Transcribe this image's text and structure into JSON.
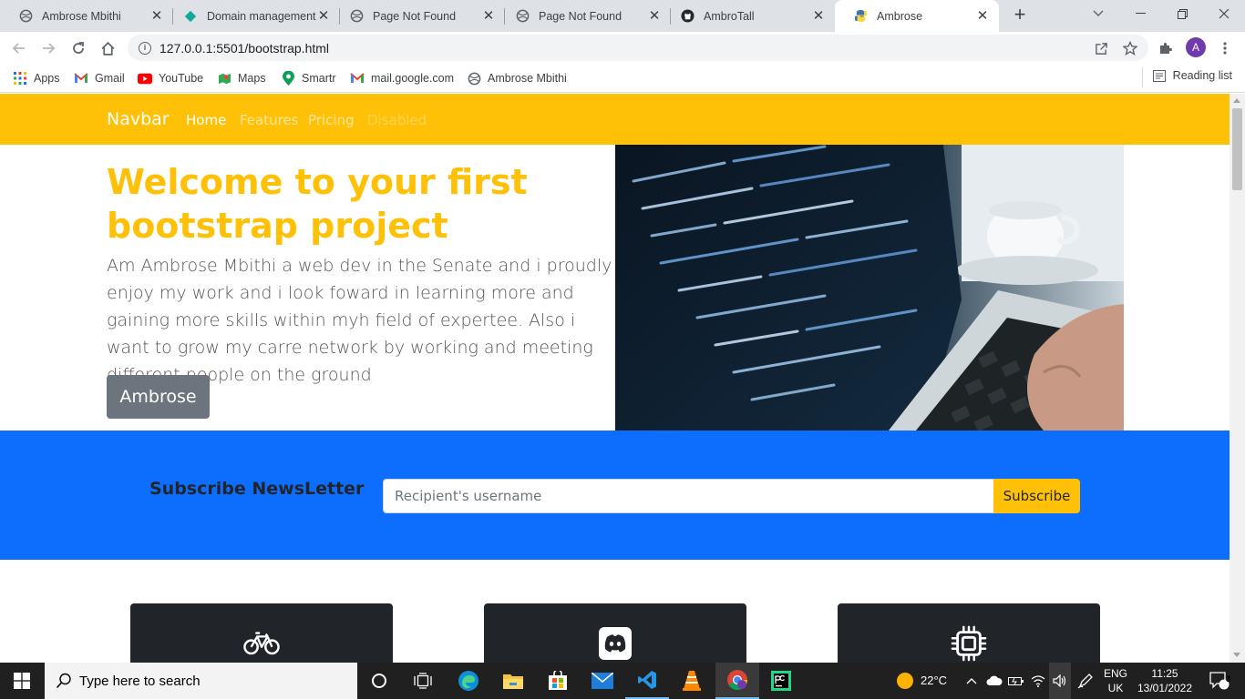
{
  "browser": {
    "tabs": [
      {
        "title": "Ambrose Mbithi",
        "icon": "globe-icon"
      },
      {
        "title": "Domain management",
        "icon": "diamond-icon"
      },
      {
        "title": "Page Not Found",
        "icon": "globe-icon"
      },
      {
        "title": "Page Not Found",
        "icon": "globe-icon"
      },
      {
        "title": "AmbroTall",
        "icon": "github-icon"
      },
      {
        "title": "Ambrose",
        "icon": "python-icon",
        "active": true
      }
    ],
    "url": "127.0.0.1:5501/bootstrap.html",
    "profile_initial": "A",
    "bookmarks": [
      "Apps",
      "Gmail",
      "YouTube",
      "Maps",
      "Smartr",
      "mail.google.com",
      "Ambrose Mbithi"
    ],
    "reading_list": "Reading list"
  },
  "page": {
    "navbar": {
      "brand": "Navbar",
      "links": [
        {
          "label": "Home",
          "state": "active"
        },
        {
          "label": "Features",
          "state": "normal"
        },
        {
          "label": "Pricing",
          "state": "normal"
        },
        {
          "label": "Disabled",
          "state": "disabled"
        }
      ]
    },
    "hero": {
      "title": "Welcome to your first bootstrap project",
      "text": "Am Ambrose Mbithi a web dev in the Senate and i proudly enjoy my work and i look foward in learning more and gaining more skills within myh field of expertee. Also i want to grow my carre network by working and meeting different people on the ground",
      "button": "Ambrose"
    },
    "subscribe": {
      "title": "Subscribe NewsLetter",
      "placeholder": "Recipient's username",
      "button": "Subscribe"
    },
    "cards": [
      {
        "icon": "bicycle-icon"
      },
      {
        "icon": "discord-icon"
      },
      {
        "icon": "cpu-icon"
      }
    ],
    "colors": {
      "warning": "#ffc107",
      "primary": "#0d6efd",
      "dark": "#212529",
      "secondary": "#6c757d"
    }
  },
  "taskbar": {
    "search_placeholder": "Type here to search",
    "weather": "22°C",
    "language": "ENG",
    "region": "UK",
    "time": "11:25",
    "date": "13/01/2022",
    "notifications": "3"
  }
}
